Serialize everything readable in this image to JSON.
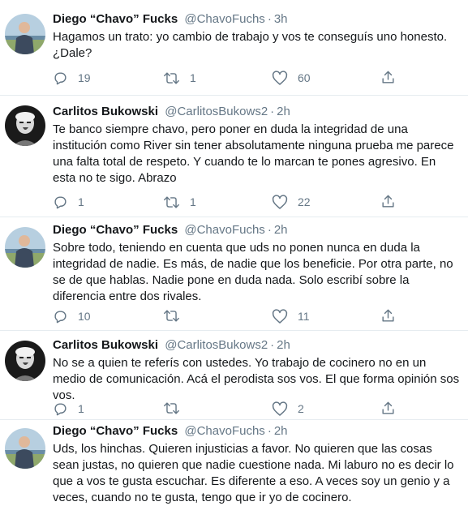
{
  "tweets": [
    {
      "name": "Diego “Chavo” Fucks",
      "handle": "@ChavoFuchs",
      "time": "3h",
      "text": "Hagamos un trato: yo cambio de trabajo y vos te conseguís uno honesto. ¿Dale?",
      "replies": "19",
      "retweets": "1",
      "likes": "60"
    },
    {
      "name": "Carlitos Bukowski",
      "handle": "@CarlitosBukows2",
      "time": "2h",
      "text": "Te banco siempre chavo, pero poner en duda la integridad de una institución como River sin tener absolutamente ninguna prueba me parece una falta total de respeto. Y cuando te lo marcan te pones agresivo. En esta no te sigo. Abrazo",
      "replies": "1",
      "retweets": "1",
      "likes": "22"
    },
    {
      "name": "Diego “Chavo” Fucks",
      "handle": "@ChavoFuchs",
      "time": "2h",
      "text": "Sobre todo, teniendo en cuenta que uds no ponen nunca en duda la integridad de nadie. Es más, de nadie que los beneficie. Por otra parte, no se de que hablas. Nadie pone en duda nada. Solo escribí sobre la diferencia entre dos rivales.",
      "replies": "10",
      "retweets": "",
      "likes": "11"
    },
    {
      "name": "Carlitos Bukowski",
      "handle": "@CarlitosBukows2",
      "time": "2h",
      "text": "No se a quien te referís con ustedes. Yo trabajo de cocinero no en un medio de comunicación. Acá el perodista sos vos. El que forma opinión sos vos.",
      "replies": "1",
      "retweets": "",
      "likes": "2"
    },
    {
      "name": "Diego “Chavo” Fucks",
      "handle": "@ChavoFuchs",
      "time": "2h",
      "text": "Uds, los hinchas. Quieren injusticias a favor. No quieren que las cosas sean justas, no quieren que nadie cuestione nada. Mi laburo no es decir lo que a vos te gusta escuchar. Es diferente a eso. A veces soy un genio y a veces, cuando no te gusta, tengo que ir yo de cocinero.",
      "replies": "",
      "retweets": "",
      "likes": ""
    }
  ],
  "icons": {
    "reply": "reply-icon",
    "retweet": "retweet-icon",
    "like": "heart-icon",
    "share": "share-icon"
  },
  "colors": {
    "name": "#14171a",
    "meta": "#657786",
    "divider": "#e6ecf0"
  }
}
